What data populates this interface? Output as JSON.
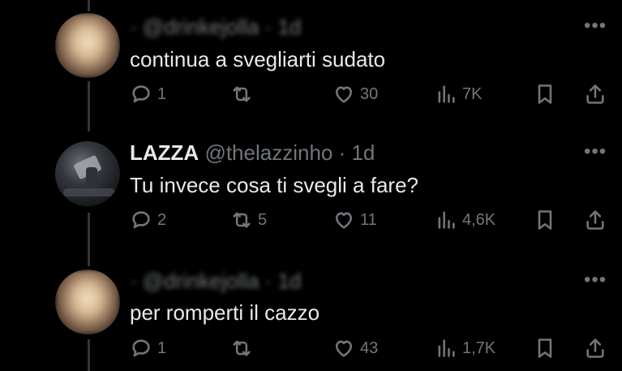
{
  "replies": [
    {
      "handle": "· @drinkejolla · 1d",
      "text": "continua a svegliarti sudato",
      "replies_count": "1",
      "reposts_count": "",
      "likes_count": "30",
      "views_count": "7K"
    },
    {
      "display_name": "LAZZA",
      "handle": "@thelazzinho · 1d",
      "text": "Tu invece cosa ti svegli a fare?",
      "replies_count": "2",
      "reposts_count": "5",
      "likes_count": "11",
      "views_count": "4,6K"
    },
    {
      "handle": "· @drinkejolla · 1d",
      "text": "per romperti il cazzo",
      "replies_count": "1",
      "reposts_count": "",
      "likes_count": "43",
      "views_count": "1,7K"
    }
  ],
  "more_label": "•••",
  "icons": [
    "reply-icon",
    "repost-icon",
    "like-icon",
    "views-icon",
    "bookmark-icon",
    "share-icon"
  ]
}
